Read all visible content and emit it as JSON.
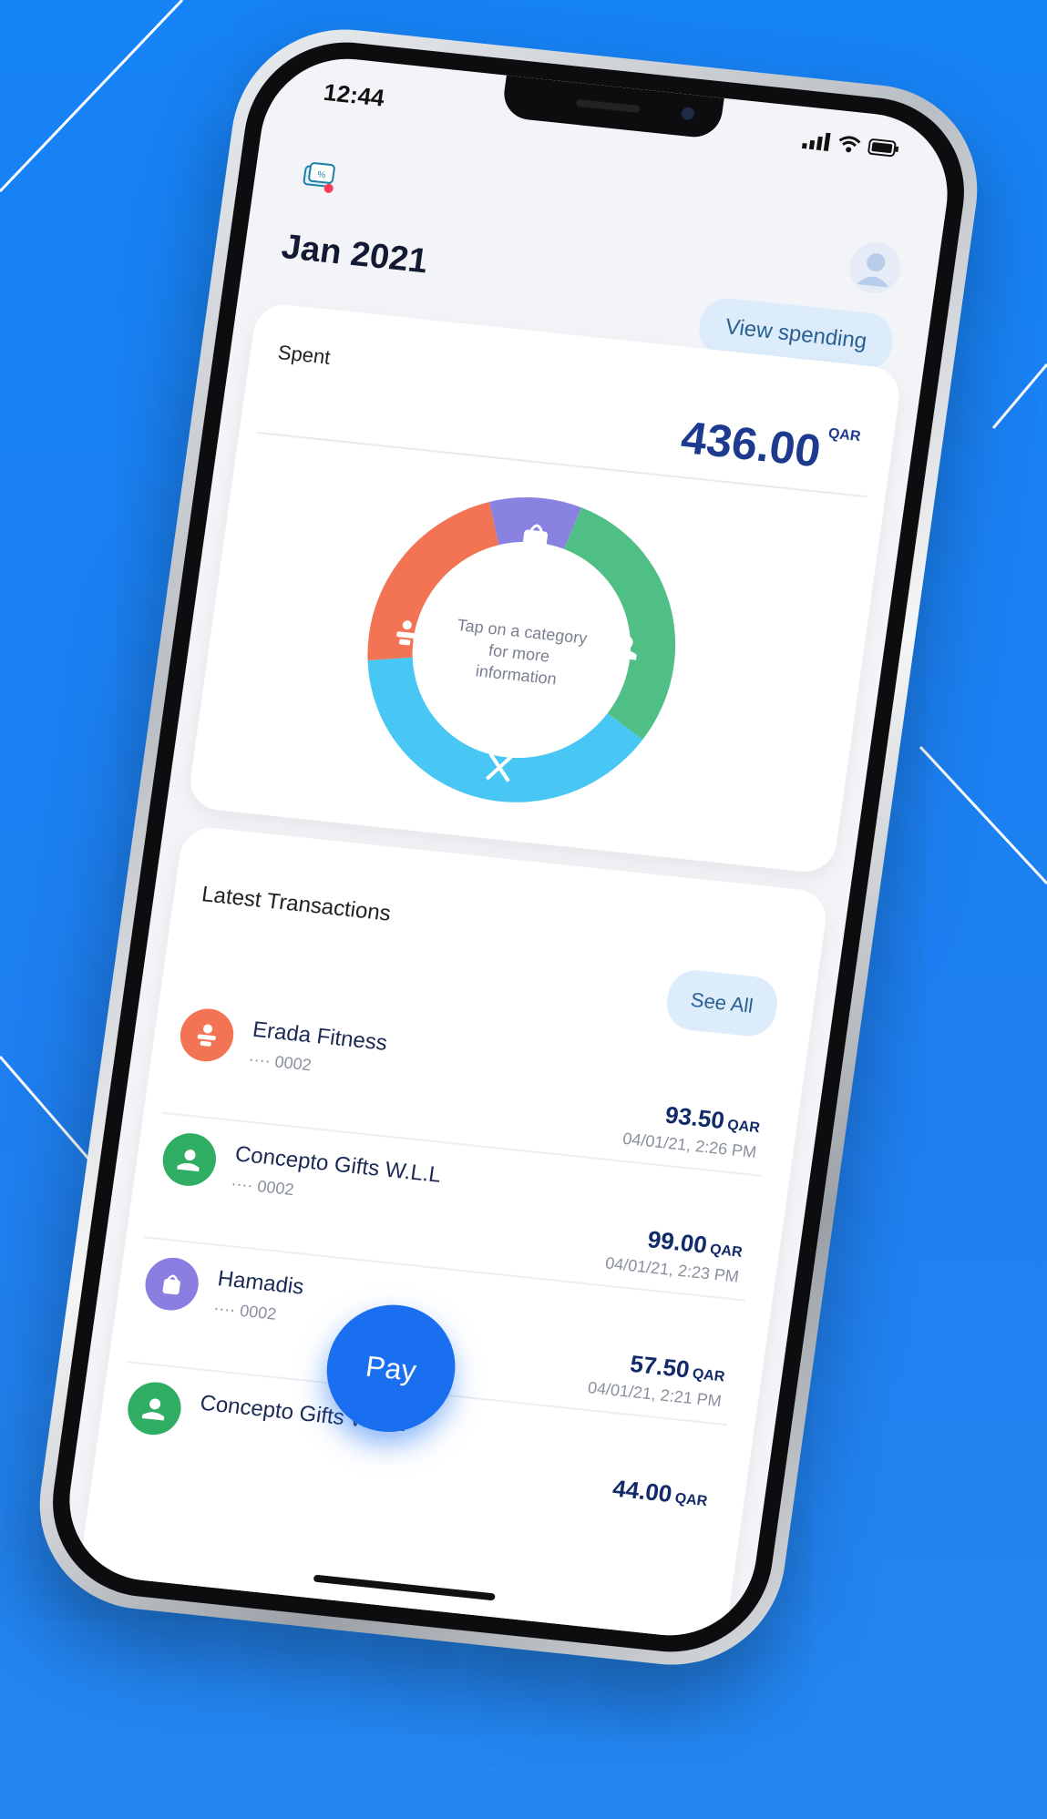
{
  "status_bar": {
    "time": "12:44"
  },
  "header": {
    "month": "Jan 2021",
    "view_spending_label": "View spending"
  },
  "spent": {
    "label": "Spent",
    "amount": "436.00",
    "currency": "QAR",
    "donut_hint": "Tap on a category for more information",
    "categories": [
      {
        "icon": "shopping-bag-icon",
        "color": "#8a82e0"
      },
      {
        "icon": "gift-hand-icon",
        "color": "#4fbf86"
      },
      {
        "icon": "fork-knife-icon",
        "color": "#48c7f5"
      },
      {
        "icon": "fitness-icon",
        "color": "#f37454"
      }
    ]
  },
  "transactions": {
    "title": "Latest Transactions",
    "see_all_label": "See All",
    "items": [
      {
        "name": "Erada Fitness",
        "card": "···· 0002",
        "amount": "93.50",
        "currency": "QAR",
        "date": "04/01/21, 2:26 PM",
        "icon": "fitness-icon",
        "color": "#f37454"
      },
      {
        "name": "Concepto Gifts W.L.L",
        "card": "···· 0002",
        "amount": "99.00",
        "currency": "QAR",
        "date": "04/01/21, 2:23 PM",
        "icon": "gift-hand-icon",
        "color": "#2fae63"
      },
      {
        "name": "Hamadis",
        "card": "···· 0002",
        "amount": "57.50",
        "currency": "QAR",
        "date": "04/01/21, 2:21 PM",
        "icon": "shopping-bag-icon",
        "color": "#8a7fe0"
      },
      {
        "name": "Concepto Gifts W.L.L",
        "card": "",
        "amount": "44.00",
        "currency": "QAR",
        "date": "",
        "icon": "gift-hand-icon",
        "color": "#2fae63"
      }
    ]
  },
  "pay_button_label": "Pay"
}
